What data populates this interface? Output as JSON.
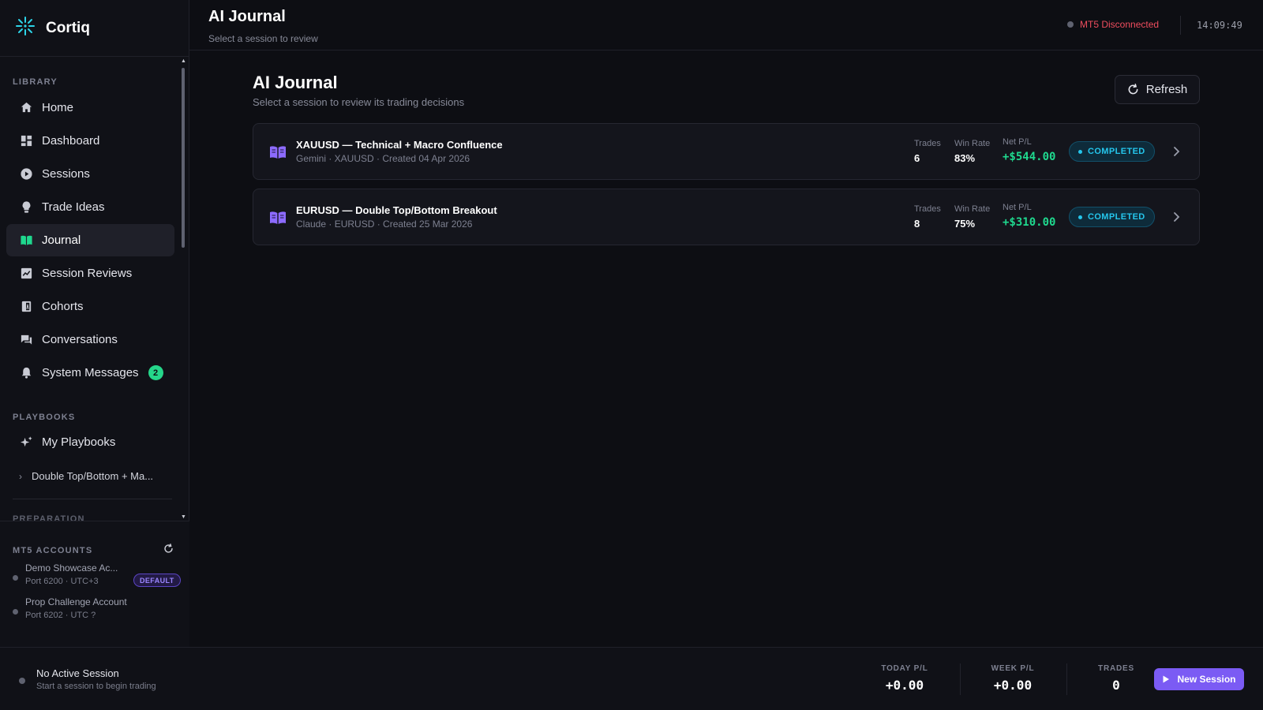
{
  "brand": {
    "name": "Cortiq"
  },
  "header": {
    "title": "AI Journal",
    "subtitle": "Select a session to review",
    "mt5_status": "MT5 Disconnected",
    "clock": "14:09:49"
  },
  "sidebar": {
    "library_label": "LIBRARY",
    "items": [
      {
        "label": "Home",
        "icon": "home-icon"
      },
      {
        "label": "Dashboard",
        "icon": "dashboard-icon"
      },
      {
        "label": "Sessions",
        "icon": "play-circle-icon"
      },
      {
        "label": "Trade Ideas",
        "icon": "lightbulb-icon"
      },
      {
        "label": "Journal",
        "icon": "journal-icon",
        "active": true
      },
      {
        "label": "Session Reviews",
        "icon": "review-chart-icon"
      },
      {
        "label": "Cohorts",
        "icon": "cohorts-icon"
      },
      {
        "label": "Conversations",
        "icon": "chat-icon"
      },
      {
        "label": "System Messages",
        "icon": "bell-icon",
        "badge": "2"
      }
    ],
    "playbooks_label": "PLAYBOOKS",
    "my_playbooks": "My Playbooks",
    "playbook_sub": "Double Top/Bottom + Ma...",
    "next_section_partial": "PREPARATION",
    "accounts_label": "MT5 ACCOUNTS",
    "accounts": [
      {
        "name": "Demo Showcase Ac...",
        "sub": "Port 6200 · UTC+3",
        "badge": "DEFAULT"
      },
      {
        "name": "Prop Challenge Account",
        "sub": "Port 6202 · UTC ?"
      }
    ]
  },
  "main": {
    "title": "AI Journal",
    "subtitle": "Select a session to review its trading decisions",
    "refresh_label": "Refresh",
    "stat_labels": {
      "trades": "Trades",
      "win_rate": "Win Rate",
      "net_pl": "Net P/L"
    },
    "sessions": [
      {
        "title": "XAUUSD — Technical + Macro Confluence",
        "meta": "Gemini · XAUUSD · Created 04 Apr 2026",
        "trades": "6",
        "win_rate": "83%",
        "net_pl": "+$544.00",
        "status": "COMPLETED"
      },
      {
        "title": "EURUSD — Double Top/Bottom Breakout",
        "meta": "Claude · EURUSD · Created 25 Mar 2026",
        "trades": "8",
        "win_rate": "75%",
        "net_pl": "+$310.00",
        "status": "COMPLETED"
      }
    ]
  },
  "footer": {
    "session_title": "No Active Session",
    "session_sub": "Start a session to begin trading",
    "today_label": "TODAY P/L",
    "today_value": "+0.00",
    "week_label": "WEEK P/L",
    "week_value": "+0.00",
    "trades_label": "TRADES",
    "trades_value": "0",
    "new_session_label": "New Session"
  },
  "colors": {
    "accent": "#7b5bf4",
    "positive": "#1fd88e",
    "completed": "#25c6ec",
    "disconnected": "#ef4d5e",
    "badge": "#25d68a"
  }
}
